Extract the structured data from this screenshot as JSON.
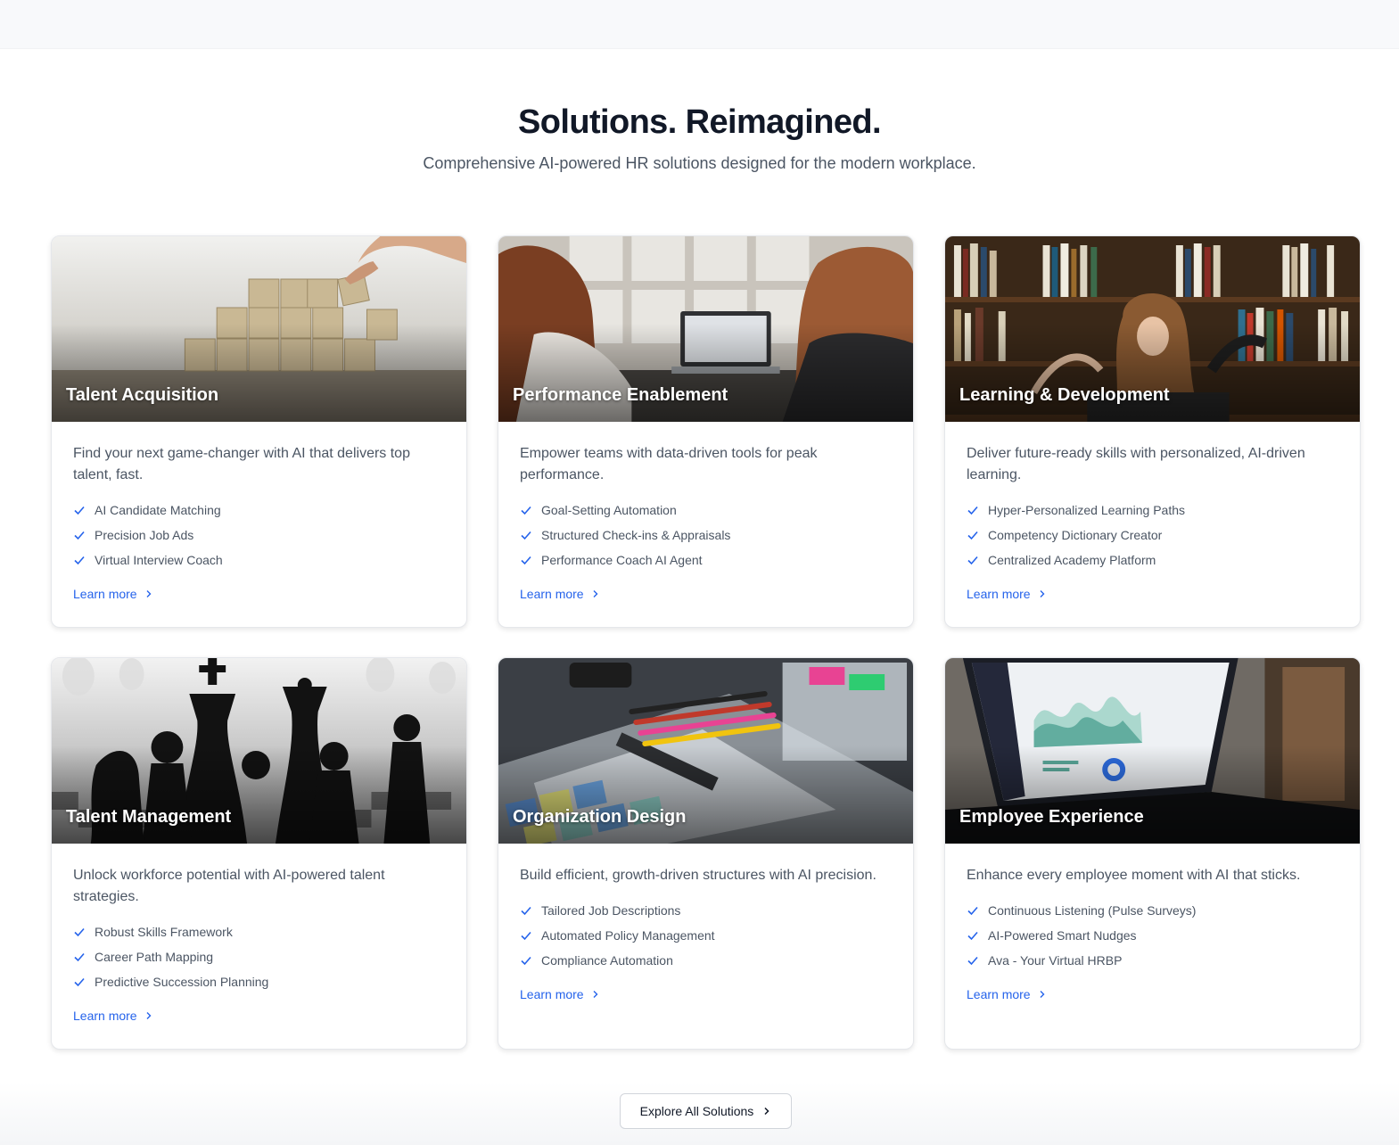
{
  "section": {
    "title": "Solutions. Reimagined.",
    "subtitle": "Comprehensive AI-powered HR solutions designed for the modern workplace."
  },
  "cards": [
    {
      "title": "Talent Acquisition",
      "description": "Find your next game-changer with AI that delivers top talent, fast.",
      "features": [
        "AI Candidate Matching",
        "Precision Job Ads",
        "Virtual Interview Coach"
      ],
      "link": "Learn more",
      "image": "wooden-blocks-photo"
    },
    {
      "title": "Performance Enablement",
      "description": "Empower teams with data-driven tools for peak performance.",
      "features": [
        "Goal-Setting Automation",
        "Structured Check-ins & Appraisals",
        "Performance Coach AI Agent"
      ],
      "link": "Learn more",
      "image": "colleagues-laptop-photo"
    },
    {
      "title": "Learning & Development",
      "description": "Deliver future-ready skills with personalized, AI-driven learning.",
      "features": [
        "Hyper-Personalized Learning Paths",
        "Competency Dictionary Creator",
        "Centralized Academy Platform"
      ],
      "link": "Learn more",
      "image": "bookshelf-photo"
    },
    {
      "title": "Talent Management",
      "description": "Unlock workforce potential with AI-powered talent strategies.",
      "features": [
        "Robust Skills Framework",
        "Career Path Mapping",
        "Predictive Succession Planning"
      ],
      "link": "Learn more",
      "image": "chess-pieces-photo"
    },
    {
      "title": "Organization Design",
      "description": "Build efficient, growth-driven structures with AI precision.",
      "features": [
        "Tailored Job Descriptions",
        "Automated Policy Management",
        "Compliance Automation"
      ],
      "link": "Learn more",
      "image": "sticky-notes-photo"
    },
    {
      "title": "Employee Experience",
      "description": "Enhance every employee moment with AI that sticks.",
      "features": [
        "Continuous Listening (Pulse Surveys)",
        "AI-Powered Smart Nudges",
        "Ava - Your Virtual HRBP"
      ],
      "link": "Learn more",
      "image": "dashboard-laptop-photo"
    }
  ],
  "cta": {
    "label": "Explore All Solutions"
  },
  "colors": {
    "accent": "#2563eb",
    "heading": "#111827",
    "body_text": "#4b5563"
  }
}
